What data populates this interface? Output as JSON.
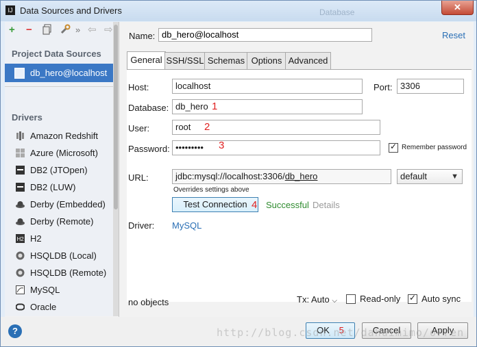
{
  "window": {
    "title": "Data Sources and Drivers",
    "app_icon": "IJ",
    "background_title": "Database",
    "close_glyph": "✕"
  },
  "toolbar": {
    "add_icon": "+",
    "remove_icon": "−",
    "copy_icon": "copy",
    "settings_icon": "wrench",
    "more_icon": "»",
    "back_icon": "⇦",
    "forward_icon": "⇨"
  },
  "sidebar": {
    "project_heading": "Project Data Sources",
    "selected_source": "db_hero@localhost",
    "drivers_heading": "Drivers",
    "drivers": [
      {
        "label": "Amazon Redshift",
        "icon": "redshift-icon"
      },
      {
        "label": "Azure (Microsoft)",
        "icon": "windows-icon"
      },
      {
        "label": "DB2 (JTOpen)",
        "icon": "db2-icon"
      },
      {
        "label": "DB2 (LUW)",
        "icon": "db2-icon"
      },
      {
        "label": "Derby (Embedded)",
        "icon": "derby-hat-icon"
      },
      {
        "label": "Derby (Remote)",
        "icon": "derby-hat-icon"
      },
      {
        "label": "H2",
        "icon": "h2-icon"
      },
      {
        "label": "HSQLDB (Local)",
        "icon": "hsqldb-icon"
      },
      {
        "label": "HSQLDB (Remote)",
        "icon": "hsqldb-icon"
      },
      {
        "label": "MySQL",
        "icon": "mysql-icon"
      },
      {
        "label": "Oracle",
        "icon": "oracle-icon"
      }
    ]
  },
  "header": {
    "name_label": "Name:",
    "name_value": "db_hero@localhost",
    "reset_label": "Reset"
  },
  "tabs": [
    "General",
    "SSH/SSL",
    "Schemas",
    "Options",
    "Advanced"
  ],
  "general": {
    "host_label": "Host:",
    "host_value": "localhost",
    "port_label": "Port:",
    "port_value": "3306",
    "database_label": "Database:",
    "database_value": "db_hero",
    "user_label": "User:",
    "user_value": "root",
    "password_label": "Password:",
    "password_value": "•••••••••",
    "remember_label": "Remember password",
    "url_label": "URL:",
    "url_prefix": "jdbc:mysql://localhost:3306/",
    "url_db": "db_hero",
    "url_mode": "default",
    "url_hint": "Overrides settings above",
    "test_button": "Test Connection",
    "test_status": "Successful",
    "details_label": "Details",
    "driver_label": "Driver:",
    "driver_value": "MySQL",
    "annotations": [
      "1",
      "2",
      "3",
      "4",
      "5"
    ]
  },
  "status": {
    "objects": "no objects",
    "tx_label": "Tx: Auto",
    "read_only_label": "Read-only",
    "auto_sync_label": "Auto sync"
  },
  "buttons": {
    "help": "?",
    "ok": "OK",
    "cancel": "Cancel",
    "apply": "Apply"
  },
  "watermark": "http://blog.csdn.net/dahuimimo/orren",
  "colors": {
    "selection": "#3b78c5",
    "link": "#2a6fb5",
    "success": "#2e8b2e",
    "annotation": "#e02020"
  }
}
